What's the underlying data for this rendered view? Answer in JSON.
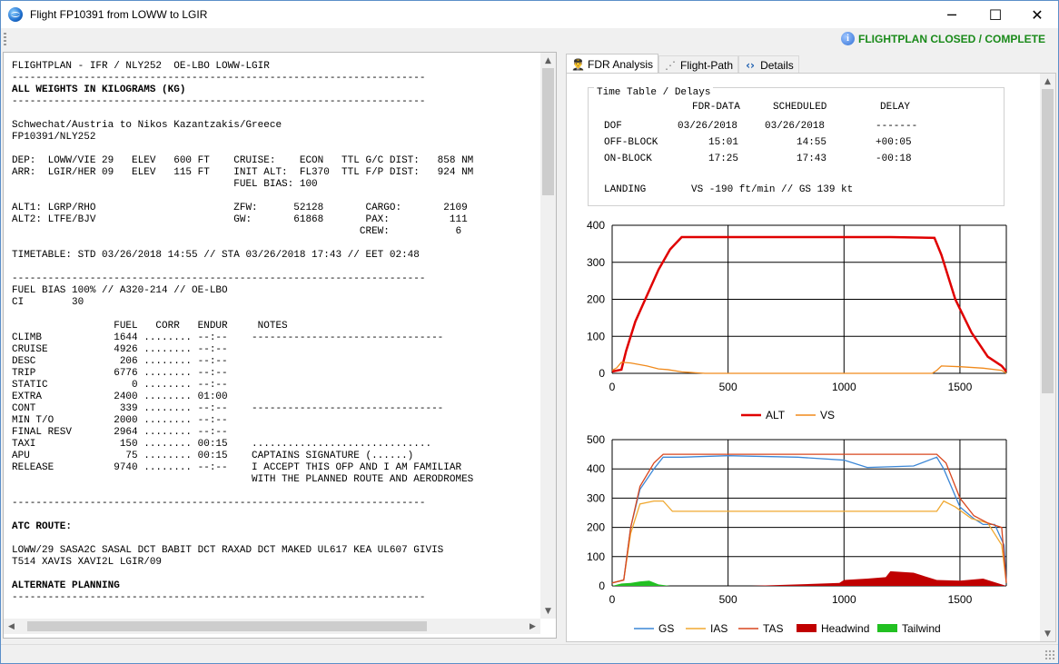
{
  "window": {
    "title": "Flight FP10391 from LOWW to LGIR",
    "buttons": {
      "minimize": "─",
      "maximize": "☐",
      "close": "✕"
    }
  },
  "toolbar": {
    "status": "FLIGHTPLAN CLOSED / COMPLETE"
  },
  "flightplan": {
    "lines": [
      "FLIGHTPLAN - IFR / NLY252  OE-LBO LOWW-LGIR",
      "---------------------------------------------------------------------",
      "ALL WEIGHTS IN KILOGRAMS (KG)",
      "---------------------------------------------------------------------",
      "",
      "Schwechat/Austria to Nikos Kazantzakis/Greece",
      "FP10391/NLY252",
      "",
      "DEP:  LOWW/VIE 29   ELEV   600 FT    CRUISE:    ECON   TTL G/C DIST:   858 NM",
      "ARR:  LGIR/HER 09   ELEV   115 FT    INIT ALT:  FL370  TTL F/P DIST:   924 NM",
      "                                     FUEL BIAS: 100",
      "",
      "ALT1: LGRP/RHO                       ZFW:      52128       CARGO:       2109",
      "ALT2: LTFE/BJV                       GW:       61868       PAX:          111",
      "                                                          CREW:           6",
      "",
      "TIMETABLE: STD 03/26/2018 14:55 // STA 03/26/2018 17:43 // EET 02:48",
      "",
      "---------------------------------------------------------------------",
      "FUEL BIAS 100% // A320-214 // OE-LBO",
      "CI        30",
      "",
      "                 FUEL   CORR   ENDUR     NOTES",
      "CLIMB            1644 ........ --:--    --------------------------------",
      "CRUISE           4926 ........ --:--",
      "DESC              206 ........ --:--",
      "TRIP             6776 ........ --:--",
      "STATIC              0 ........ --:--",
      "EXTRA            2400 ........ 01:00",
      "CONT              339 ........ --:--    --------------------------------",
      "MIN T/O          2000 ........ --:--",
      "FINAL RESV       2964 ........ --:--",
      "TAXI              150 ........ 00:15    ..............................",
      "APU                75 ........ 00:15    CAPTAINS SIGNATURE (......)",
      "RELEASE          9740 ........ --:--    I ACCEPT THIS OFP AND I AM FAMILIAR",
      "                                        WITH THE PLANNED ROUTE AND AERODROMES",
      "",
      "---------------------------------------------------------------------",
      "",
      "ATC ROUTE:",
      "",
      "LOWW/29 SASA2C SASAL DCT BABIT DCT RAXAD DCT MAKED UL617 KEA UL607 GIVIS",
      "T514 XAVIS XAVI2L LGIR/09",
      "",
      "ALTERNATE PLANNING",
      "---------------------------------------------------------------------"
    ]
  },
  "tabs": [
    {
      "label": "FDR Analysis",
      "icon": "pilot-icon"
    },
    {
      "label": "Flight-Path",
      "icon": "path-icon"
    },
    {
      "label": "Details",
      "icon": "code-icon"
    }
  ],
  "timetable": {
    "legend": "Time Table / Delays",
    "headers": [
      "FDR-DATA",
      "SCHEDULED",
      "DELAY"
    ],
    "rows": [
      {
        "label": "DOF",
        "fdr": "03/26/2018",
        "sched": "03/26/2018",
        "delay": "-------"
      },
      {
        "label": "OFF-BLOCK",
        "fdr": "15:01",
        "sched": "14:55",
        "delay": "+00:05"
      },
      {
        "label": "ON-BLOCK",
        "fdr": "17:25",
        "sched": "17:43",
        "delay": "-00:18"
      }
    ],
    "landing_label": "LANDING",
    "landing_value": "VS -190 ft/min // GS 139 kt"
  },
  "chart_data": [
    {
      "type": "line",
      "xlim": [
        0,
        1700
      ],
      "ylim": [
        0,
        400
      ],
      "x_ticks": [
        "0",
        "500",
        "1000",
        "1500"
      ],
      "y_ticks": [
        "0",
        "100",
        "200",
        "300",
        "400"
      ],
      "grid": true,
      "legend": "bottom",
      "colors": {
        "ALT": "#e00000",
        "VS": "#f08a1c"
      },
      "series": [
        {
          "name": "ALT",
          "x": [
            0,
            40,
            60,
            100,
            150,
            200,
            250,
            300,
            600,
            900,
            1200,
            1390,
            1420,
            1480,
            1550,
            1620,
            1680,
            1700
          ],
          "values": [
            5,
            10,
            60,
            140,
            210,
            280,
            335,
            368,
            368,
            368,
            368,
            366,
            320,
            200,
            110,
            45,
            20,
            5
          ]
        },
        {
          "name": "VS",
          "x": [
            0,
            20,
            40,
            80,
            150,
            200,
            240,
            300,
            400,
            800,
            1380,
            1400,
            1420,
            1500,
            1600,
            1680,
            1700
          ],
          "values": [
            8,
            15,
            30,
            28,
            20,
            12,
            10,
            4,
            0,
            0,
            0,
            8,
            20,
            18,
            14,
            8,
            0
          ]
        }
      ]
    },
    {
      "type": "line",
      "xlim": [
        0,
        1700
      ],
      "ylim": [
        0,
        500
      ],
      "x_ticks": [
        "0",
        "500",
        "1000",
        "1500"
      ],
      "y_ticks": [
        "0",
        "100",
        "200",
        "300",
        "400",
        "500"
      ],
      "grid": true,
      "legend": "bottom",
      "colors": {
        "GS": "#3c87d6",
        "IAS": "#f0a830",
        "TAS": "#d9471e",
        "Headwind": "#c00000",
        "Tailwind": "#22c022"
      },
      "series": [
        {
          "name": "GS",
          "x": [
            0,
            50,
            80,
            120,
            180,
            220,
            300,
            500,
            800,
            1000,
            1100,
            1300,
            1400,
            1430,
            1500,
            1560,
            1600,
            1650,
            1690,
            1700
          ],
          "values": [
            10,
            20,
            200,
            330,
            400,
            440,
            440,
            445,
            440,
            430,
            405,
            410,
            440,
            400,
            270,
            230,
            210,
            210,
            140,
            10
          ]
        },
        {
          "name": "IAS",
          "x": [
            0,
            50,
            80,
            120,
            180,
            220,
            260,
            300,
            500,
            1000,
            1400,
            1430,
            1480,
            1550,
            1620,
            1680,
            1700
          ],
          "values": [
            10,
            20,
            180,
            280,
            290,
            290,
            255,
            255,
            255,
            255,
            255,
            290,
            270,
            230,
            215,
            140,
            10
          ]
        },
        {
          "name": "TAS",
          "x": [
            0,
            50,
            80,
            120,
            180,
            220,
            300,
            500,
            1000,
            1400,
            1440,
            1500,
            1560,
            1620,
            1680,
            1700
          ],
          "values": [
            10,
            20,
            200,
            340,
            420,
            450,
            450,
            450,
            450,
            450,
            420,
            300,
            240,
            215,
            200,
            10
          ]
        },
        {
          "name": "Headwind",
          "x": [
            0,
            100,
            200,
            600,
            800,
            980,
            1000,
            1100,
            1180,
            1200,
            1300,
            1400,
            1500,
            1600,
            1700
          ],
          "values": [
            0,
            0,
            0,
            0,
            5,
            10,
            20,
            25,
            30,
            50,
            45,
            20,
            18,
            25,
            0
          ]
        },
        {
          "name": "Tailwind",
          "x": [
            0,
            40,
            80,
            120,
            160,
            200,
            250,
            1700
          ],
          "values": [
            0,
            8,
            10,
            15,
            18,
            5,
            0,
            0
          ]
        }
      ]
    }
  ]
}
